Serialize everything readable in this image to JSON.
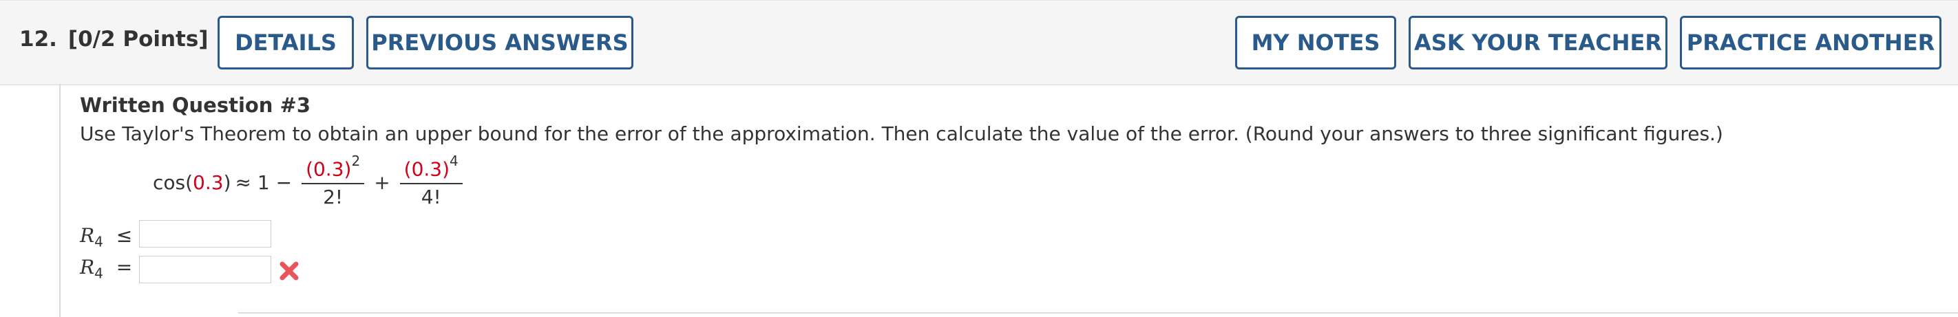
{
  "question": {
    "number": "12.",
    "points": "[0/2 Points]"
  },
  "toolbar": {
    "details_label": "DETAILS",
    "previous_answers_label": "PREVIOUS ANSWERS",
    "my_notes_label": "MY NOTES",
    "ask_teacher_label": "ASK YOUR TEACHER",
    "practice_another_label": "PRACTICE ANOTHER"
  },
  "content": {
    "title": "Written Question #3",
    "prompt": "Use Taylor's Theorem to obtain an upper bound for the error of the approximation. Then calculate the value of the error. (Round your answers to three significant figures.)",
    "formula": {
      "lhs_func": "cos(",
      "arg": "0.3",
      "lhs_close": ")",
      "approx": "≈ 1 −",
      "term1_num_base": "(0.3)",
      "term1_num_exp": "2",
      "term1_den": "2!",
      "plus": "+",
      "term2_num_base": "(0.3)",
      "term2_num_exp": "4",
      "term2_den": "4!"
    }
  },
  "answers": [
    {
      "var": "R",
      "sub": "4",
      "relation": "≤",
      "value": ""
    },
    {
      "var": "R",
      "sub": "4",
      "relation": "=",
      "value": "",
      "status": "incorrect"
    }
  ],
  "colors": {
    "button_border": "#2a5a8a",
    "highlight_red": "#d0021b",
    "incorrect_mark": "#e8565a"
  }
}
